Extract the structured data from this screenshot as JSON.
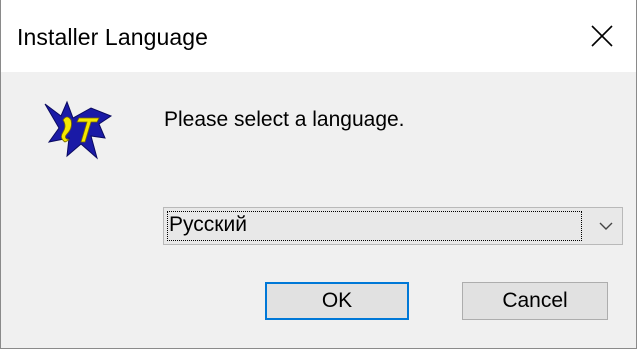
{
  "window": {
    "title": "Installer Language"
  },
  "icons": {
    "close": "close-icon",
    "logo": "installer-logo-icon",
    "dropdown": "chevron-down-icon"
  },
  "dialog": {
    "prompt": "Please select a language.",
    "language_select": {
      "selected": "Русский"
    },
    "ok_label": "OK",
    "cancel_label": "Cancel"
  },
  "colors": {
    "accent": "#0078d7",
    "logo_primary": "#1a1aa6",
    "logo_secondary": "#f5e800"
  }
}
